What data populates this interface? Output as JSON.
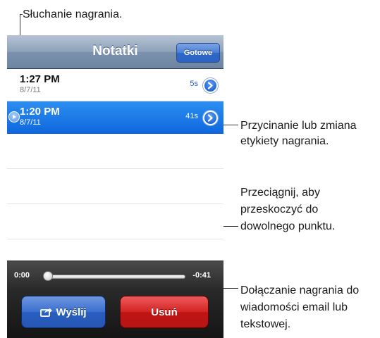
{
  "callouts": {
    "listen": "Słuchanie nagrania.",
    "trim_line1": "Przycinanie lub zmiana",
    "trim_line2": "etykiety nagrania.",
    "drag_line1": "Przeciągnij, aby",
    "drag_line2": "przeskoczyć do",
    "drag_line3": "dowolnego punktu.",
    "attach_line1": "Dołączanie nagrania do",
    "attach_line2": "wiadomości email lub",
    "attach_line3": "tekstowej."
  },
  "navbar": {
    "title": "Notatki",
    "done_label": "Gotowe"
  },
  "recordings": [
    {
      "time": "1:27 PM",
      "date": "8/7/11",
      "duration": "5s",
      "selected": false
    },
    {
      "time": "1:20 PM",
      "date": "8/7/11",
      "duration": "41s",
      "selected": true
    }
  ],
  "scrubber": {
    "elapsed": "0:00",
    "remaining": "-0:41",
    "progress": 0
  },
  "toolbar": {
    "share_label": "Wyślij",
    "delete_label": "Usuń"
  },
  "colors": {
    "selected_row": "#1a78e6",
    "share_button": "#3a6fcf",
    "delete_button": "#d42424",
    "navbar": "#8ea2bb"
  },
  "icons": {
    "play": "play-icon",
    "disclosure": "disclosure-arrow-icon",
    "share": "share-icon"
  }
}
